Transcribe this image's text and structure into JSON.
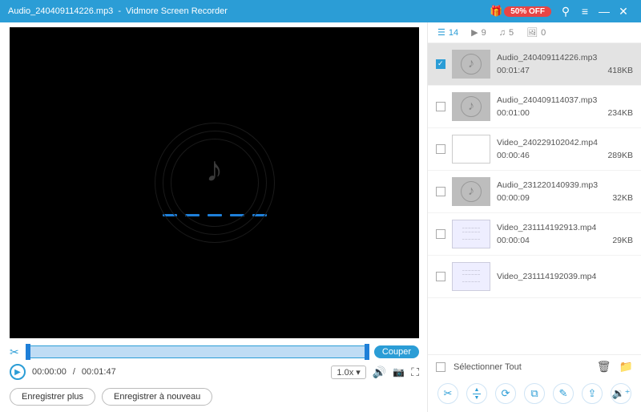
{
  "titlebar": {
    "filename": "Audio_240409114226.mp3",
    "app": "Vidmore Screen Recorder",
    "promo": "50% OFF"
  },
  "player": {
    "time_current": "00:00:00",
    "time_total": "00:01:47",
    "speed": "1.0x",
    "cut_label": "Couper"
  },
  "buttons": {
    "record_more": "Enregistrer plus",
    "rerecord": "Enregistrer à nouveau"
  },
  "tabs": {
    "all": "14",
    "video": "9",
    "audio": "5",
    "image": "0"
  },
  "items": [
    {
      "name": "Audio_240409114226.mp3",
      "dur": "00:01:47",
      "size": "418KB",
      "type": "audio",
      "checked": true,
      "selected": true
    },
    {
      "name": "Audio_240409114037.mp3",
      "dur": "00:01:00",
      "size": "234KB",
      "type": "audio",
      "checked": false,
      "selected": false
    },
    {
      "name": "Video_240229102042.mp4",
      "dur": "00:00:46",
      "size": "289KB",
      "type": "video",
      "checked": false,
      "selected": false
    },
    {
      "name": "Audio_231220140939.mp3",
      "dur": "00:00:09",
      "size": "32KB",
      "type": "audio",
      "checked": false,
      "selected": false
    },
    {
      "name": "Video_231114192913.mp4",
      "dur": "00:00:04",
      "size": "29KB",
      "type": "video2",
      "checked": false,
      "selected": false
    },
    {
      "name": "Video_231114192039.mp4",
      "dur": "",
      "size": "",
      "type": "video2",
      "checked": false,
      "selected": false
    }
  ],
  "footer": {
    "select_all": "Sélectionner Tout"
  }
}
